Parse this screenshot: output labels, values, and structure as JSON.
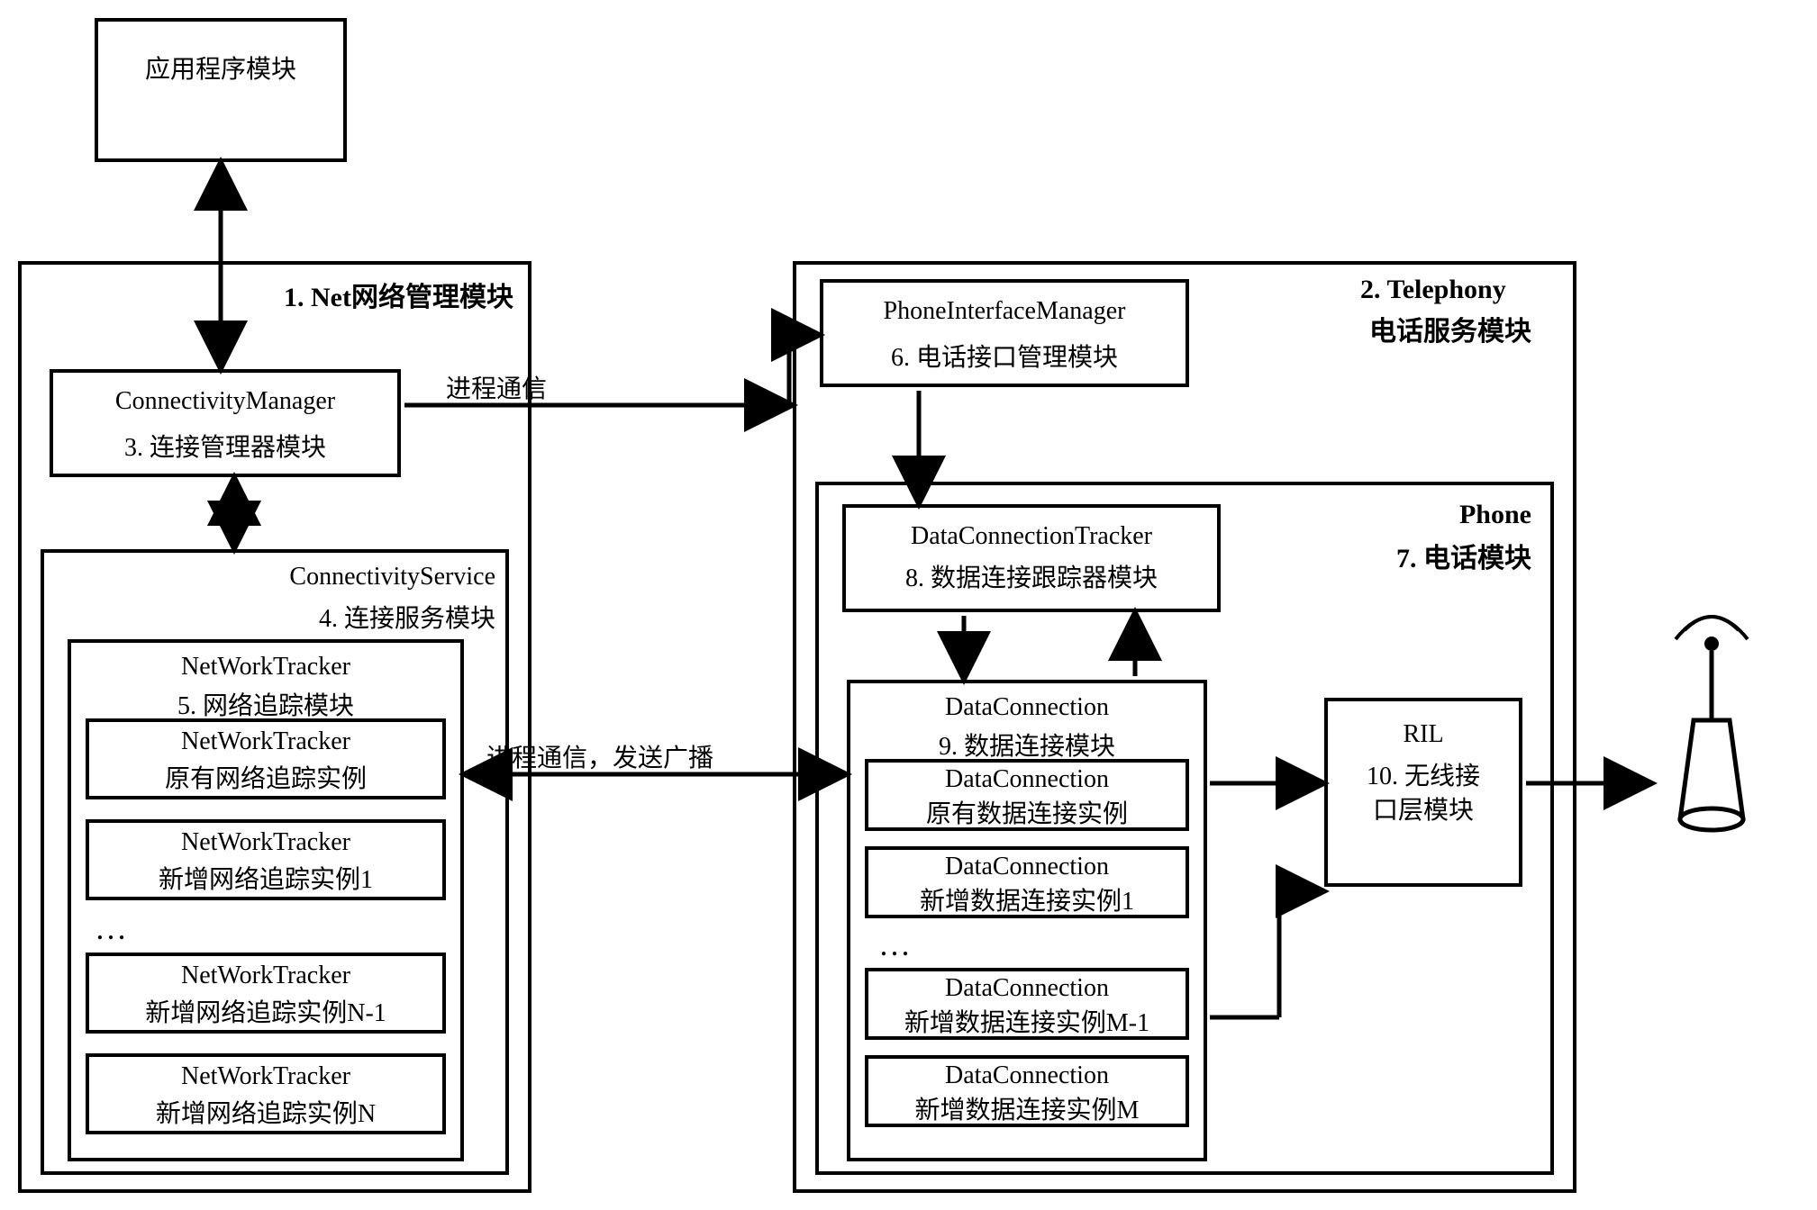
{
  "app_module": "应用程序模块",
  "net_module_title": "1. Net网络管理模块",
  "telephony_module_title": "2. Telephony\n电话服务模块",
  "connectivity_manager": {
    "en": "ConnectivityManager",
    "cn": "3. 连接管理器模块"
  },
  "connectivity_service": {
    "en": "ConnectivityService",
    "cn": "4. 连接服务模块"
  },
  "network_tracker": {
    "en": "NetWorkTracker",
    "cn": "5. 网络追踪模块"
  },
  "nt_instances": [
    {
      "en": "NetWorkTracker",
      "cn": "原有网络追踪实例"
    },
    {
      "en": "NetWorkTracker",
      "cn": "新增网络追踪实例1"
    },
    {
      "en": "NetWorkTracker",
      "cn": "新增网络追踪实例N-1"
    },
    {
      "en": "NetWorkTracker",
      "cn": "新增网络追踪实例N"
    }
  ],
  "ellipsis": "…",
  "phone_interface_manager": {
    "en": "PhoneInterfaceManager",
    "cn": "6. 电话接口管理模块"
  },
  "phone_module": {
    "en": "Phone",
    "cn": "7. 电话模块"
  },
  "data_connection_tracker": {
    "en": "DataConnectionTracker",
    "cn": "8. 数据连接跟踪器模块"
  },
  "data_connection": {
    "en": "DataConnection",
    "cn": "9. 数据连接模块"
  },
  "dc_instances": [
    {
      "en": "DataConnection",
      "cn": "原有数据连接实例"
    },
    {
      "en": "DataConnection",
      "cn": "新增数据连接实例1"
    },
    {
      "en": "DataConnection",
      "cn": "新增数据连接实例M-1"
    },
    {
      "en": "DataConnection",
      "cn": "新增数据连接实例M"
    }
  ],
  "ril": {
    "en": "RIL",
    "cn": "10. 无线接口层模块"
  },
  "ipc_label": "进程通信",
  "ipc_broadcast_label": "进程通信，发送广播"
}
